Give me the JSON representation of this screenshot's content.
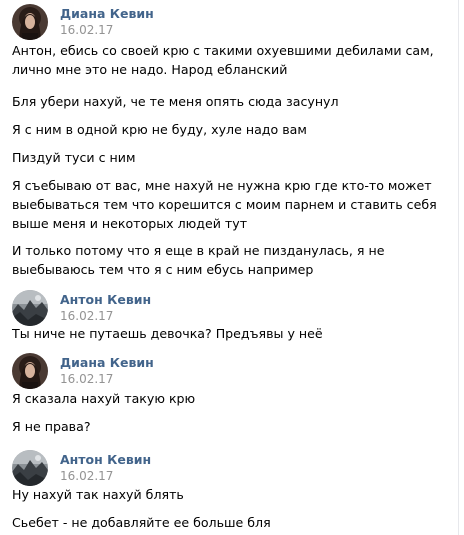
{
  "messages": [
    {
      "author": "Диана Кевин",
      "date": "16.02.17",
      "avatar": "diana-avatar",
      "texts": [
        "Антон, ебись со своей крю с такими охуевшими дебилами сам, лично мне это не надо. Народ ебланский",
        "Бля убери нахуй, че те меня опять сюда засунул",
        "Я с ним в одной крю не буду, хуле надо вам",
        "Пиздуй туси с ним",
        "Я съебываю от вас, мне нахуй не нужна крю где кто-то может выебываться тем что корешится с моим парнем и ставить себя выше меня и некоторых людей тут",
        "И только потому что я еще в край не пизданулась, я не выебываюсь тем что я с ним ебусь например"
      ]
    },
    {
      "author": "Антон Кевин",
      "date": "16.02.17",
      "avatar": "anton-avatar",
      "texts": [
        "Ты ниче не путаешь девочка? Предъявы у неё"
      ]
    },
    {
      "author": "Диана Кевин",
      "date": "16.02.17",
      "avatar": "diana-avatar",
      "texts": [
        "Я сказала нахуй такую крю",
        "Я не права?"
      ]
    },
    {
      "author": "Антон Кевин",
      "date": "16.02.17",
      "avatar": "anton-avatar",
      "texts": [
        "Ну нахуй так нахуй блять",
        "Сьебет - не добавляйте ее больше бля"
      ]
    }
  ],
  "colors": {
    "author": "#42648b",
    "date": "#939393",
    "text": "#000000",
    "background": "#ffffff"
  }
}
